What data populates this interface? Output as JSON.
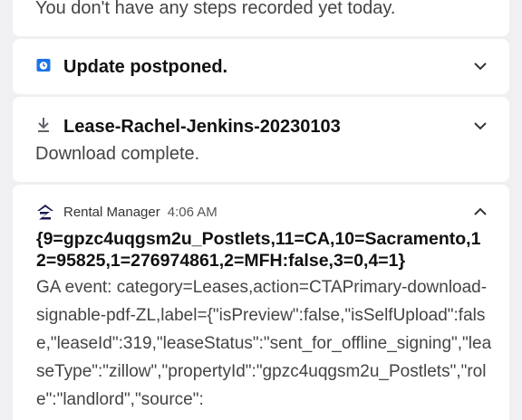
{
  "notifications": {
    "steps": {
      "text": "You don't have any steps recorded yet today."
    },
    "update": {
      "title": "Update postponed.",
      "icon": "calendar-clock-icon",
      "icon_color": "#1a73e8"
    },
    "download": {
      "title": "Lease-Rachel-Jenkins-20230103",
      "subtitle": "Download complete.",
      "icon": "download-icon"
    },
    "rental": {
      "app_name": "Rental Manager",
      "time": "4:06 AM",
      "app_icon": "zillow-z-icon",
      "title": "{9=gpzc4uqgsm2u_Postlets,11=CA,10=Sacramento,12=95825,1=276974861,2=MFH:false,3=0,4=1}",
      "body": "GA event: category=Leases,action=CTAPrimary-download-signable-pdf-ZL,label={\"isPreview\":false,\"isSelfUpload\":false,\"leaseId\":319,\"leaseStatus\":\"sent_for_offline_signing\",\"leaseType\":\"zillow\",\"propertyId\":\"gpzc4uqgsm2u_Postlets\",\"role\":\"landlord\",\"source\":"
    }
  }
}
